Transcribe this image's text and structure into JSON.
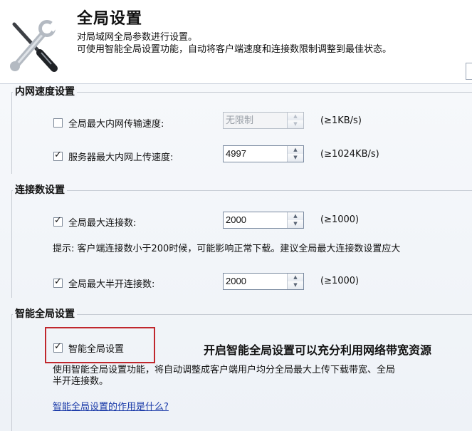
{
  "header": {
    "title": "全局设置",
    "desc_line1": "对局域网全局参数进行设置。",
    "desc_line2": "可使用智能全局设置功能，自动将客户端速度和连接数限制调整到最佳状态。",
    "icon": "wrench-screwdriver-icon"
  },
  "speed_group": {
    "title": "内网速度设置",
    "rows": [
      {
        "label": "全局最大内网传输速度:",
        "checked": false,
        "value": "无限制",
        "range": "(≥1KB/s)",
        "disabled": true
      },
      {
        "label": "服务器最大内网上传速度:",
        "checked": true,
        "value": "4997",
        "range": "(≥1024KB/s)",
        "disabled": false
      }
    ]
  },
  "conn_group": {
    "title": "连接数设置",
    "rows": [
      {
        "label": "全局最大连接数:",
        "checked": true,
        "value": "2000",
        "range": "(≥1000)"
      },
      {
        "label": "全局最大半开连接数:",
        "checked": true,
        "value": "2000",
        "range": "(≥1000)"
      }
    ],
    "hint": "提示:  客户端连接数小于200时候，可能影响正常下载。建议全局最大连接数设置应大"
  },
  "smart_group": {
    "title": "智能全局设置",
    "checkbox_label": "智能全局设置",
    "checked": true,
    "callout": "开启智能全局设置可以充分利用网络带宽资源",
    "desc_line1": "使用智能全局设置功能，将自动调整成客户端用户均分全局最大上传下载带宽、全局",
    "desc_line2": "半开连接数。",
    "link": "智能全局设置的作用是什么?"
  }
}
